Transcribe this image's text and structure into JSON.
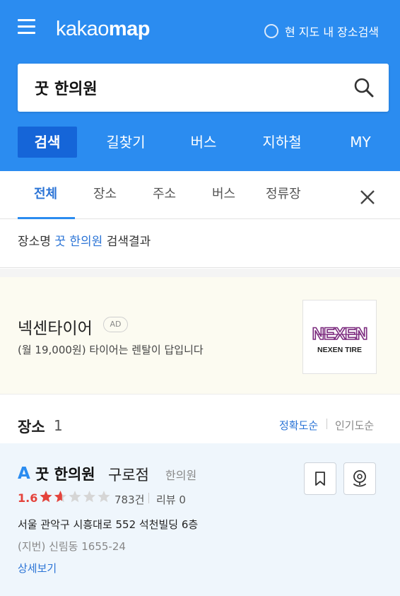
{
  "header": {
    "logo_light": "kakao",
    "logo_bold": "map",
    "area_search_label": "현 지도 내 장소검색",
    "search": {
      "value": "꿋 한의원",
      "placeholder": ""
    },
    "mode_tabs": [
      {
        "label": "검색",
        "active": true
      },
      {
        "label": "길찾기",
        "active": false
      },
      {
        "label": "버스",
        "active": false
      },
      {
        "label": "지하철",
        "active": false
      },
      {
        "label": "MY",
        "active": false
      }
    ],
    "color_bg": "#2b8cf0",
    "color_active_tab": "#1565d8"
  },
  "category_tabs": [
    {
      "label": "전체",
      "active": true
    },
    {
      "label": "장소",
      "active": false
    },
    {
      "label": "주소",
      "active": false
    },
    {
      "label": "버스",
      "active": false
    },
    {
      "label": "정류장",
      "active": false
    }
  ],
  "result_summary": {
    "prefix": "장소명",
    "keyword": "꿋 한의원",
    "suffix": "검색결과"
  },
  "ad": {
    "title": "넥센타이어",
    "badge": "AD",
    "description": "(월 19,000원) 타이어는 렌탈이 답입니다",
    "logo_text": "NEXEN",
    "logo_subtext": "NEXEN TIRE",
    "logo_color": "#7b2a7e"
  },
  "places": {
    "title": "장소",
    "count": "1",
    "sort_accuracy": "정확도순",
    "sort_popular": "인기도순",
    "items": [
      {
        "marker": "A",
        "name": "꿋 한의원",
        "branch": "구로점",
        "category": "한의원",
        "rating": "1.6",
        "rating_value": 1.6,
        "rating_max": 5,
        "review_count": "783건",
        "review_label": "리뷰 0",
        "address": "서울 관악구 시흥대로 552 석천빌딩 6층",
        "jibun": "(지번) 신림동 1655-24",
        "more_label": "상세보기"
      }
    ]
  }
}
